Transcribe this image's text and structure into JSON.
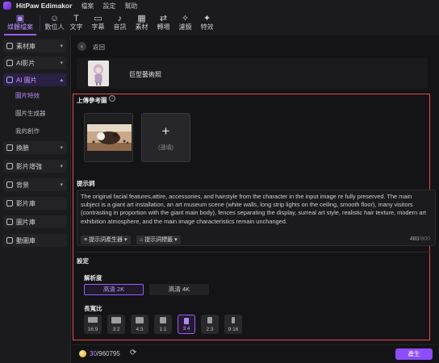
{
  "app": {
    "title": "HitPaw Edimakor",
    "menu": [
      "檔案",
      "設定",
      "幫助"
    ]
  },
  "toolbar": [
    {
      "label": "媒體檔案",
      "icon": "media-icon",
      "glyph": "▣",
      "active": true
    },
    {
      "label": "數位人",
      "icon": "digital-human-icon",
      "glyph": "☺"
    },
    {
      "label": "文字",
      "icon": "text-icon",
      "glyph": "T"
    },
    {
      "label": "字幕",
      "icon": "subtitle-icon",
      "glyph": "▭"
    },
    {
      "label": "音訊",
      "icon": "audio-icon",
      "glyph": "♪"
    },
    {
      "label": "素材",
      "icon": "assets-icon",
      "glyph": "▦"
    },
    {
      "label": "轉場",
      "icon": "transition-icon",
      "glyph": "⇄"
    },
    {
      "label": "濾鏡",
      "icon": "filter-icon",
      "glyph": "✧"
    },
    {
      "label": "特效",
      "icon": "effects-icon",
      "glyph": "✦"
    }
  ],
  "sidebar": {
    "items": [
      {
        "label": "素材庫",
        "icon": "library-icon",
        "caret": "▾"
      },
      {
        "label": "AI影片",
        "icon": "ai-video-icon",
        "caret": "▾"
      },
      {
        "label": "AI 圖片",
        "icon": "ai-image-icon",
        "caret": "▴",
        "open": true
      }
    ],
    "subitems": [
      {
        "label": "圖片特效",
        "active": true
      },
      {
        "label": "圖片生成器"
      },
      {
        "label": "我的創作"
      }
    ],
    "items2": [
      {
        "label": "換臉",
        "icon": "face-swap-icon",
        "caret": "▾"
      },
      {
        "label": "影片增強",
        "icon": "video-enhance-icon",
        "caret": "▾"
      },
      {
        "label": "背景",
        "icon": "background-icon",
        "caret": "▾"
      },
      {
        "label": "影片庫",
        "icon": "video-library-icon"
      },
      {
        "label": "圖片庫",
        "icon": "image-library-icon"
      },
      {
        "label": "動圖庫",
        "icon": "gif-library-icon"
      }
    ]
  },
  "main": {
    "back_label": "返回",
    "template_name": "巨型藝術照",
    "upload_title": "上傳參考圖",
    "upload_optional": "(選填)",
    "prompt_title": "提示詞",
    "prompt_text": "The original facial features,attire, accessories, and hairstyle from the character in the input image re fully preserved. The main subject is a giant art installation, an art museum scene (white walls, long strip lights on the ceiling, smooth floor), many visitors (contrasting in proportion with the giant main body), fences separating the display, surreal art style, realistic hair texture, modern art exhibition atmosphere, and the main image characteristics remain unchanged.",
    "prompt_generator_label": "提示詞產生器",
    "prompt_tags_label": "提示詞標籤",
    "char_count": "480",
    "char_max": "/800",
    "settings_title": "設定",
    "resolution_title": "解析度",
    "resolution_options": [
      {
        "label": "高清 2K",
        "selected": true
      },
      {
        "label": "高清 4K"
      }
    ],
    "ratio_title": "長寬比",
    "ratios": [
      {
        "label": "16:9",
        "w": 16,
        "h": 9
      },
      {
        "label": "3:2",
        "w": 15,
        "h": 10
      },
      {
        "label": "4:3",
        "w": 14,
        "h": 10.5
      },
      {
        "label": "1:1",
        "w": 10,
        "h": 10
      },
      {
        "label": "3:4",
        "w": 8,
        "h": 10.5,
        "selected": true
      },
      {
        "label": "2:3",
        "w": 7,
        "h": 10.5
      },
      {
        "label": "9:16",
        "w": 6,
        "h": 10.5
      }
    ]
  },
  "footer": {
    "credits_used": "30",
    "credits_total": "/960795",
    "generate_label": "產生"
  },
  "colors": {
    "accent": "#9a5cff",
    "highlight_border": "#e5484d",
    "background": "#141416"
  }
}
